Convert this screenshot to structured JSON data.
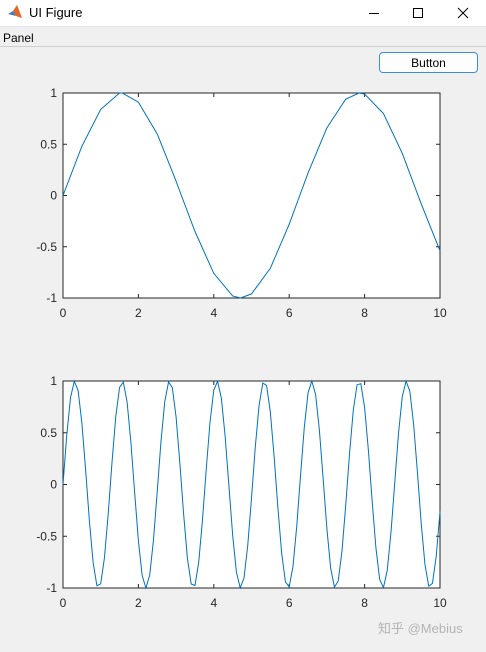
{
  "window": {
    "title": "UI Figure"
  },
  "panel": {
    "title": "Panel"
  },
  "button": {
    "label": "Button"
  },
  "watermark": "知乎 @Mebius",
  "colors": {
    "line": "#0072bd",
    "axes": "#262626",
    "background": "#f0f0f0",
    "button_border": "#3c8fd0"
  },
  "icons": {
    "app": "matlab-icon",
    "minimize": "minimize-icon",
    "maximize": "maximize-icon",
    "close": "close-icon"
  },
  "chart_data": [
    {
      "type": "line",
      "title": "",
      "xlabel": "",
      "ylabel": "",
      "xlim": [
        0,
        10
      ],
      "ylim": [
        -1,
        1
      ],
      "x_ticks": [
        "0",
        "2",
        "4",
        "6",
        "8",
        "10"
      ],
      "y_ticks": [
        "1",
        "0.5",
        "0",
        "-0.5",
        "-1"
      ],
      "grid": false,
      "series": [
        {
          "function": "sin(x)",
          "x": [
            0,
            0.5,
            1,
            1.5,
            1.57,
            2,
            2.5,
            3,
            3.14,
            3.5,
            4,
            4.5,
            4.71,
            5,
            5.5,
            6,
            6.28,
            6.5,
            7,
            7.5,
            7.85,
            8,
            8.5,
            9,
            9.5,
            10
          ],
          "y": [
            0,
            0.48,
            0.84,
            1.0,
            1.0,
            0.91,
            0.6,
            0.14,
            0,
            -0.35,
            -0.76,
            -0.98,
            -1.0,
            -0.96,
            -0.71,
            -0.28,
            0,
            0.22,
            0.66,
            0.94,
            1.0,
            0.99,
            0.8,
            0.41,
            -0.08,
            -0.54
          ]
        }
      ]
    },
    {
      "type": "line",
      "title": "",
      "xlabel": "",
      "ylabel": "",
      "xlim": [
        0,
        10
      ],
      "ylim": [
        -1,
        1
      ],
      "x_ticks": [
        "0",
        "2",
        "4",
        "6",
        "8",
        "10"
      ],
      "y_ticks": [
        "1",
        "0.5",
        "0",
        "-0.5",
        "-1"
      ],
      "grid": false,
      "series": [
        {
          "function": "sin(5x)",
          "x": [
            0,
            0.1,
            0.2,
            0.3,
            0.4,
            0.5,
            0.6,
            0.7,
            0.8,
            0.9,
            1.0,
            1.1,
            1.2,
            1.3,
            1.4,
            1.5,
            1.6,
            1.7,
            1.8,
            1.9,
            2.0,
            2.1,
            2.2,
            2.3,
            2.4,
            2.5,
            2.6,
            2.7,
            2.8,
            2.9,
            3.0,
            3.1,
            3.2,
            3.3,
            3.4,
            3.5,
            3.6,
            3.7,
            3.8,
            3.9,
            4.0,
            4.1,
            4.2,
            4.3,
            4.4,
            4.5,
            4.6,
            4.7,
            4.8,
            4.9,
            5.0,
            5.1,
            5.2,
            5.3,
            5.4,
            5.5,
            5.6,
            5.7,
            5.8,
            5.9,
            6.0,
            6.1,
            6.2,
            6.3,
            6.4,
            6.5,
            6.6,
            6.7,
            6.8,
            6.9,
            7.0,
            7.1,
            7.2,
            7.3,
            7.4,
            7.5,
            7.6,
            7.7,
            7.8,
            7.9,
            8.0,
            8.1,
            8.2,
            8.3,
            8.4,
            8.5,
            8.6,
            8.7,
            8.8,
            8.9,
            9.0,
            9.1,
            9.2,
            9.3,
            9.4,
            9.5,
            9.6,
            9.7,
            9.8,
            9.9,
            10.0
          ],
          "y": [
            0.0,
            0.479,
            0.841,
            0.997,
            0.909,
            0.598,
            0.141,
            -0.351,
            -0.757,
            -0.978,
            -0.959,
            -0.706,
            -0.279,
            0.215,
            0.657,
            0.938,
            0.989,
            0.798,
            0.412,
            -0.075,
            -0.544,
            -0.88,
            -0.9999,
            -0.875,
            -0.537,
            -0.066,
            0.42,
            0.803,
            0.991,
            0.935,
            0.65,
            0.206,
            -0.288,
            -0.712,
            -0.961,
            -0.976,
            -0.751,
            -0.342,
            0.15,
            0.604,
            0.913,
            0.997,
            0.836,
            0.47,
            -0.009,
            -0.488,
            -0.847,
            -0.998,
            -0.906,
            -0.59,
            -0.132,
            0.36,
            0.763,
            0.98,
            0.957,
            0.699,
            0.27,
            -0.224,
            -0.663,
            -0.941,
            -0.988,
            -0.793,
            -0.404,
            0.084,
            0.551,
            0.885,
            0.9999,
            0.87,
            0.529,
            0.057,
            -0.428,
            -0.808,
            -0.992,
            -0.932,
            -0.643,
            -0.197,
            0.296,
            0.718,
            0.963,
            0.974,
            0.745,
            0.333,
            -0.159,
            -0.611,
            -0.916,
            -0.996,
            -0.831,
            -0.462,
            0.018,
            0.496,
            0.851,
            0.998,
            0.902,
            0.582,
            0.123,
            -0.369,
            -0.769,
            -0.982,
            -0.955,
            -0.693,
            -0.262
          ]
        }
      ]
    }
  ]
}
